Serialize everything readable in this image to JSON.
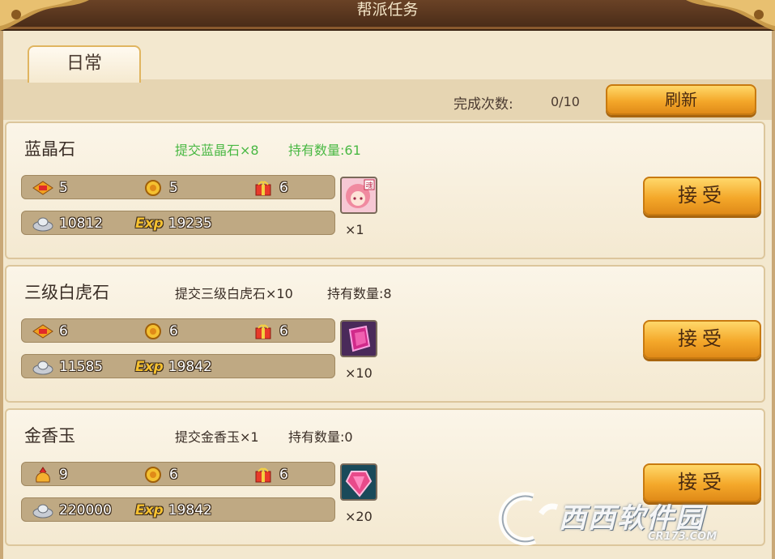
{
  "window": {
    "title": "帮派任务"
  },
  "tabs": [
    {
      "label": "日常"
    }
  ],
  "toolbar": {
    "count_label": "完成次数:",
    "count_value": "0/10",
    "refresh_label": "刷新"
  },
  "tasks": [
    {
      "name": "蓝晶石",
      "requirement": "提交蓝晶石×8",
      "held": "持有数量:61",
      "requirement_met": true,
      "rewards": {
        "r1": "5",
        "r2": "5",
        "r3": "6",
        "silver": "10812",
        "exp": "19235"
      },
      "item_icon": "pink-hair-character-soul",
      "item_badge": "魂",
      "item_qty": "×1",
      "accept_label": "接受"
    },
    {
      "name": "三级白虎石",
      "requirement": "提交三级白虎石×10",
      "held": "持有数量:8",
      "requirement_met": false,
      "rewards": {
        "r1": "6",
        "r2": "6",
        "r3": "6",
        "silver": "11585",
        "exp": "19842"
      },
      "item_icon": "purple-gem-icon",
      "item_qty": "×10",
      "accept_label": "接受"
    },
    {
      "name": "金香玉",
      "requirement": "提交金香玉×1",
      "held": "持有数量:0",
      "requirement_met": false,
      "rewards": {
        "r1": "9",
        "r2": "6",
        "r3": "6",
        "silver": "220000",
        "exp": "19842"
      },
      "item_icon": "pink-crystal-icon",
      "item_qty": "×20",
      "accept_label": "接受"
    }
  ],
  "reward_icons": {
    "r1_first": "red-gem-medal-icon",
    "r1_third": "gold-pouch-icon",
    "r2": "gold-coin-icon",
    "r3": "gift-box-icon",
    "silver": "silver-ingot-icon",
    "exp": "exp-icon"
  },
  "exp_text": "Exp",
  "watermark": {
    "text": "西西软件园",
    "sub": "CR173.COM"
  },
  "colors": {
    "accent_gold": "#f4a82a",
    "met_green": "#49b843"
  }
}
